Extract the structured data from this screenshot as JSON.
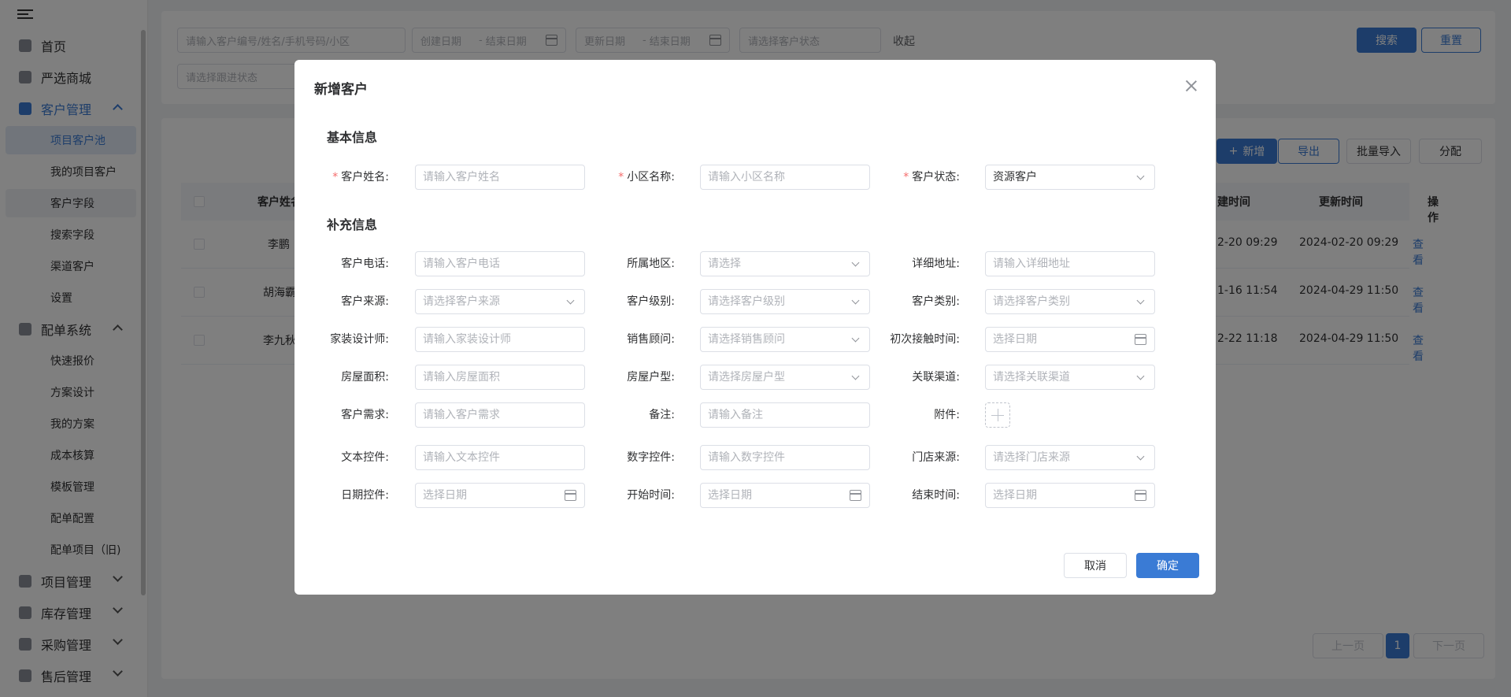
{
  "sidebar": {
    "items": [
      {
        "label": "首页",
        "icon": "home-icon"
      },
      {
        "label": "严选商城",
        "icon": "mall-icon"
      },
      {
        "label": "客户管理",
        "icon": "customer-icon"
      },
      {
        "label": "配单系统",
        "icon": "order-icon"
      },
      {
        "label": "项目管理",
        "icon": "folder-icon"
      },
      {
        "label": "库存管理",
        "icon": "inventory-icon"
      },
      {
        "label": "采购管理",
        "icon": "cart-icon"
      },
      {
        "label": "售后管理",
        "icon": "headset-icon"
      }
    ],
    "customer_sub": [
      "项目客户池",
      "我的项目客户",
      "客户字段",
      "搜索字段",
      "渠道客户",
      "设置"
    ],
    "order_sub": [
      "快速报价",
      "方案设计",
      "我的方案",
      "成本核算",
      "模板管理",
      "配单配置",
      "配单项目（旧)"
    ]
  },
  "filters": {
    "search_placeholder": "请输入客户编号/姓名/手机号码/小区",
    "created_start": "创建日期",
    "created_end": "结束日期",
    "updated_start": "更新日期",
    "updated_end": "结束日期",
    "status_placeholder": "请选择客户状态",
    "collapse": "收起",
    "follow_placeholder": "请选择跟进状态",
    "search_btn": "搜索",
    "reset_btn": "重置"
  },
  "toolbar": {
    "add": "新增",
    "export": "导出",
    "batch_import": "批量导入",
    "assign": "分配"
  },
  "table": {
    "headers": {
      "name": "客户姓名",
      "created": "建时间",
      "updated": "更新时间",
      "action": "操作"
    },
    "rows": [
      {
        "name": "李鹏",
        "created": "2-20 09:29",
        "updated": "2024-02-20 09:29",
        "action": "查看"
      },
      {
        "name": "胡海霸",
        "created": "1-16 11:54",
        "updated": "2024-04-29 11:50",
        "action": "查看"
      },
      {
        "name": "李九秋",
        "created": "2-22 11:18",
        "updated": "2024-04-29 11:50",
        "action": "查看"
      }
    ]
  },
  "pagination": {
    "prev": "上一页",
    "page": "1",
    "next": "下一页"
  },
  "dialog": {
    "title": "新增客户",
    "basic_title": "基本信息",
    "extra_title": "补充信息",
    "basic": [
      {
        "label": "客户姓名:",
        "placeholder": "请输入客户姓名",
        "type": "input",
        "required": true
      },
      {
        "label": "小区名称:",
        "placeholder": "请输入小区名称",
        "type": "input",
        "required": true
      },
      {
        "label": "客户状态:",
        "placeholder": "资源客户",
        "type": "select",
        "required": true,
        "filled": true
      }
    ],
    "extra": [
      [
        {
          "label": "客户电话:",
          "placeholder": "请输入客户电话",
          "type": "input"
        },
        {
          "label": "所属地区:",
          "placeholder": "请选择",
          "type": "select"
        },
        {
          "label": "详细地址:",
          "placeholder": "请输入详细地址",
          "type": "input"
        }
      ],
      [
        {
          "label": "客户来源:",
          "placeholder": "请选择客户来源",
          "type": "select"
        },
        {
          "label": "客户级别:",
          "placeholder": "请选择客户级别",
          "type": "select"
        },
        {
          "label": "客户类别:",
          "placeholder": "请选择客户类别",
          "type": "select"
        }
      ],
      [
        {
          "label": "家装设计师:",
          "placeholder": "请输入家装设计师",
          "type": "input"
        },
        {
          "label": "销售顾问:",
          "placeholder": "请选择销售顾问",
          "type": "select"
        },
        {
          "label": "初次接触时间:",
          "placeholder": "选择日期",
          "type": "date"
        }
      ],
      [
        {
          "label": "房屋面积:",
          "placeholder": "请输入房屋面积",
          "type": "input"
        },
        {
          "label": "房屋户型:",
          "placeholder": "请选择房屋户型",
          "type": "select"
        },
        {
          "label": "关联渠道:",
          "placeholder": "请选择关联渠道",
          "type": "select"
        }
      ],
      [
        {
          "label": "客户需求:",
          "placeholder": "请输入客户需求",
          "type": "input"
        },
        {
          "label": "备注:",
          "placeholder": "请输入备注",
          "type": "input"
        },
        {
          "label": "附件:",
          "placeholder": "",
          "type": "upload"
        }
      ],
      [
        {
          "label": "文本控件:",
          "placeholder": "请输入文本控件",
          "type": "input"
        },
        {
          "label": "数字控件:",
          "placeholder": "请输入数字控件",
          "type": "input"
        },
        {
          "label": "门店来源:",
          "placeholder": "请选择门店来源",
          "type": "select"
        }
      ],
      [
        {
          "label": "日期控件:",
          "placeholder": "选择日期",
          "type": "date"
        },
        {
          "label": "开始时间:",
          "placeholder": "选择日期",
          "type": "date"
        },
        {
          "label": "结束时间:",
          "placeholder": "选择日期",
          "type": "date"
        }
      ]
    ],
    "cancel": "取消",
    "confirm": "确定"
  },
  "colors": {
    "primary": "#3a7bd5",
    "required": "#f56c6c"
  }
}
